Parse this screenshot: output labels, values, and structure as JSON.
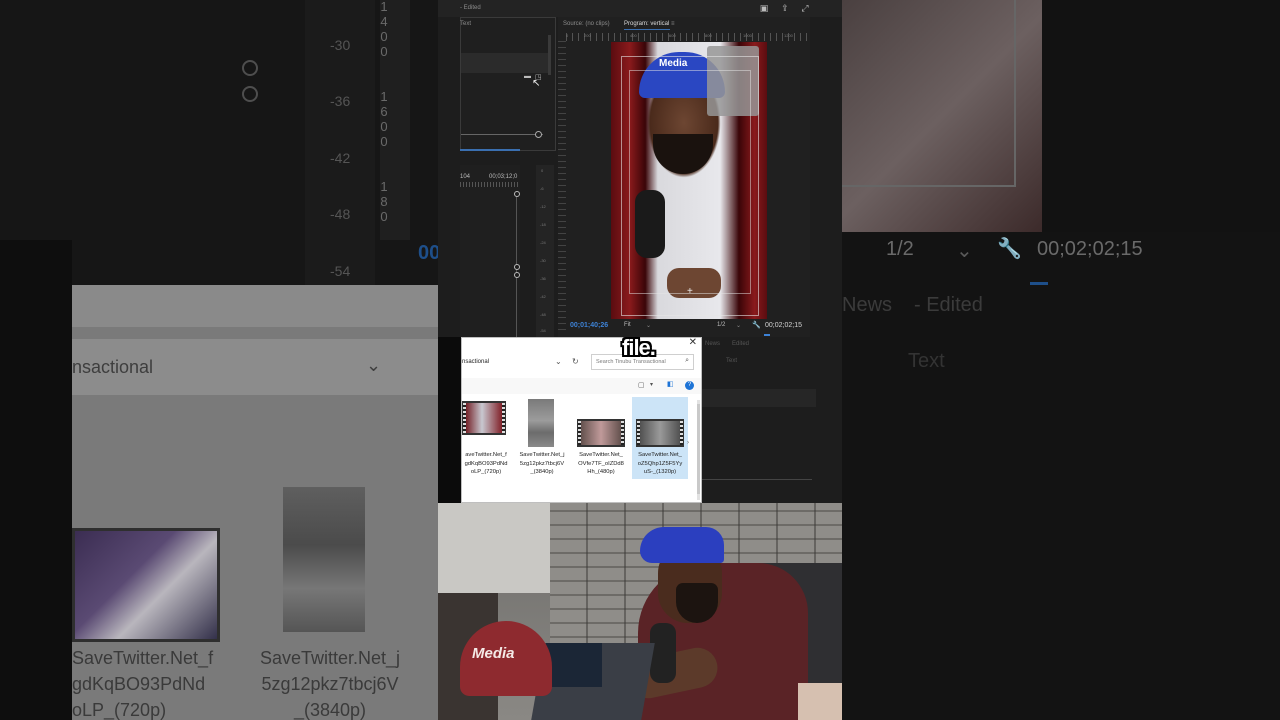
{
  "background_left": {
    "meter_digits": [
      "1",
      "4",
      "0",
      "0",
      "1",
      "6",
      "0",
      "0",
      "1",
      "8",
      "0",
      "0"
    ],
    "db_labels": [
      "-30",
      "-36",
      "-42",
      "-48",
      "-54"
    ],
    "partial_timecode": "00",
    "address_text": "nsactional",
    "file_names": [
      [
        "SaveTwitter.Net_f",
        "gdKqBO93PdNd",
        "oLP_(720p)"
      ],
      [
        "SaveTwitter.Net_j",
        "5zg12pkz7tbcj6V",
        "_(3840p)"
      ]
    ]
  },
  "background_right": {
    "zoom": "1/2",
    "timecode": "00;02;02;15",
    "title_partial": "News",
    "edited": "- Edited",
    "text_tab": "Text"
  },
  "premiere": {
    "title": "- Edited",
    "panel_label": "Text",
    "source_tab": "Source: (no clips)",
    "program_tab": "Program: vertical",
    "program_menu_icon": "≡",
    "timeline_timecodes": [
      "104",
      "00;03;12;0"
    ],
    "meter_ticks": [
      "0",
      "-6",
      "-12",
      "-18",
      "-24",
      "-30",
      "-36",
      "-42",
      "-48",
      "-54"
    ],
    "ruler_labels": [
      "0",
      "200",
      "400",
      "600",
      "800",
      "1000",
      "1200"
    ],
    "cap_logo": "Media",
    "current_timecode": "00;01;40;26",
    "fit": "Fit",
    "resolution": "1/2",
    "duration": "00;02;02;15",
    "behind_dialog": [
      "News",
      "Edited",
      "Text"
    ]
  },
  "file_dialog": {
    "address": "nsactional",
    "search_placeholder": "Search Tinubu Transactional",
    "files": [
      {
        "lines": [
          "aveTwitter.Net_f",
          "gdKqBO93PdNd",
          "oLP_(720p)"
        ],
        "selected": false
      },
      {
        "lines": [
          "SaveTwitter.Net_j",
          "5zg12pkz7tbcj6V",
          "_(3840p)"
        ],
        "selected": false
      },
      {
        "lines": [
          "SaveTwitter.Net_",
          "OVfe7TF_oIZDd8",
          "Hh_(480p)"
        ],
        "selected": false
      },
      {
        "lines": [
          "SaveTwitter.Net_",
          "oZ5Qhp1Z5F5Yy",
          "uS-_(1320p)"
        ],
        "selected": true
      }
    ]
  },
  "caption": "file.",
  "webcam": {
    "red_cap_logo": "Media"
  }
}
